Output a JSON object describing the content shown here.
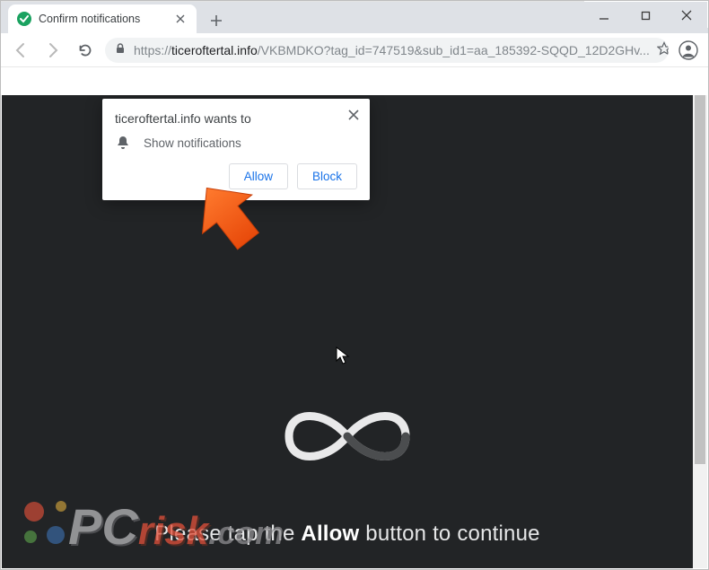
{
  "window": {
    "tab_title": "Confirm notifications",
    "minimize_icon": "minimize-icon",
    "maximize_icon": "maximize-icon",
    "close_icon": "close-icon"
  },
  "omnibox": {
    "scheme": "https://",
    "host": "ticeroftertal.info",
    "path": "/VKBMDKO?tag_id=747519&sub_id1=aa_185392-SQQD_12D2GHv..."
  },
  "notification": {
    "title": "ticeroftertal.info wants to",
    "perm_label": "Show notifications",
    "allow_label": "Allow",
    "block_label": "Block"
  },
  "page": {
    "msg_before": "Please tap the ",
    "msg_bold": "Allow",
    "msg_after": " button to continue"
  },
  "watermark": {
    "p": "P",
    "c": "C",
    "risk": "risk",
    "com": ".com"
  },
  "colors": {
    "accent_orange": "#ff5c1a",
    "link_blue": "#1a73e8",
    "dark_bg": "#222426"
  }
}
